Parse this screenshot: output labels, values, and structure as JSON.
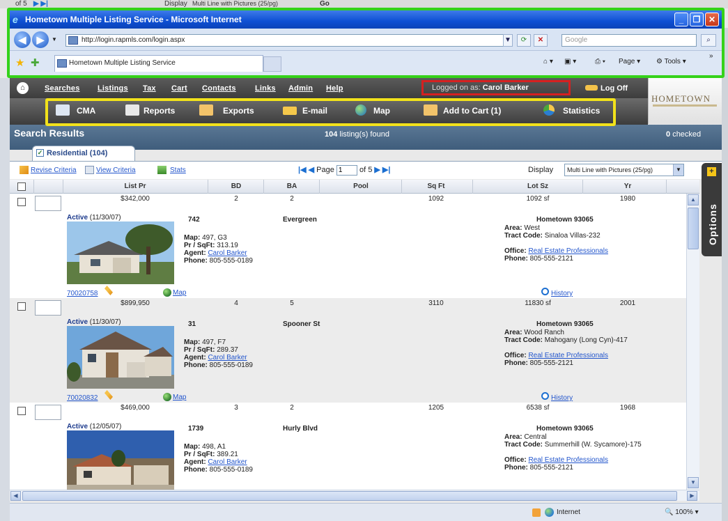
{
  "top_strip": {
    "pager_text": "of 5",
    "display_label": "Display",
    "display_value": "Multi Line with Pictures (25/pg)",
    "go": "Go"
  },
  "window": {
    "title": "Hometown Multiple Listing Service - Microsoft Internet"
  },
  "browser": {
    "url": "http://login.rapmls.com/login.aspx",
    "search_placeholder": "Google",
    "tab_title": "Hometown Multiple Listing Service",
    "page_menu": "Page",
    "tools_menu": "Tools"
  },
  "menu": {
    "items": [
      "Searches",
      "Listings",
      "Tax",
      "Cart",
      "Contacts",
      "Links",
      "Admin",
      "Help"
    ],
    "logged_on_prefix": "Logged on as:",
    "logged_on_user": "Carol Barker",
    "log_off": "Log Off"
  },
  "brand": {
    "name": "HOMETOWN"
  },
  "toolbar": {
    "cma": "CMA",
    "reports": "Reports",
    "exports": "Exports",
    "email": "E-mail",
    "map": "Map",
    "add_to_cart": "Add to Cart (1)",
    "statistics": "Statistics"
  },
  "results": {
    "title": "Search Results",
    "found_count": "104",
    "found_suffix": "listing(s) found",
    "checked_count": "0",
    "checked_suffix": "checked",
    "tab_label": "Residential (104)"
  },
  "criteria": {
    "revise": "Revise Criteria",
    "view": "View Criteria",
    "stats": "Stats",
    "page_label": "Page",
    "page_value": "1",
    "of_pages": "of 5",
    "display_label": "Display",
    "display_value": "Multi Line with Pictures (25/pg)"
  },
  "options_label": "Options",
  "table": {
    "headers": [
      "List Pr",
      "BD",
      "BA",
      "Pool",
      "Sq Ft",
      "Lot Sz",
      "Yr"
    ],
    "rows": [
      {
        "price": "$342,000",
        "bd": "2",
        "ba": "2",
        "pool": "",
        "sqft": "1092",
        "lot": "1092 sf",
        "yr": "1980",
        "status": "Active",
        "date": "(11/30/07)",
        "num": "742",
        "street": "Evergreen",
        "map": "497, G3",
        "pr_sqft": "313.19",
        "agent": "Carol Barker",
        "phone": "805-555-0189",
        "city": "Hometown 93065",
        "area": "West",
        "tract": "Sinaloa Villas-232",
        "office": "Real Estate Professionals",
        "office_phone": "805-555-2121",
        "mls": "70020758"
      },
      {
        "price": "$899,950",
        "bd": "4",
        "ba": "5",
        "pool": "",
        "sqft": "3110",
        "lot": "11830 sf",
        "yr": "2001",
        "status": "Active",
        "date": "(11/30/07)",
        "num": "31",
        "street": "Spooner St",
        "map": "497, F7",
        "pr_sqft": "289.37",
        "agent": "Carol Barker",
        "phone": "805-555-0189",
        "city": "Hometown 93065",
        "area": "Wood Ranch",
        "tract": "Mahogany (Long Cyn)-417",
        "office": "Real Estate Professionals",
        "office_phone": "805-555-2121",
        "mls": "70020832"
      },
      {
        "price": "$469,000",
        "bd": "3",
        "ba": "2",
        "pool": "",
        "sqft": "1205",
        "lot": "6538 sf",
        "yr": "1968",
        "status": "Active",
        "date": "(12/05/07)",
        "num": "1739",
        "street": "Hurly Blvd",
        "map": "498, A1",
        "pr_sqft": "389.21",
        "agent": "Carol Barker",
        "phone": "805-555-0189",
        "city": "Hometown 93065",
        "area": "Central",
        "tract": "Summerhill (W. Sycamore)-175",
        "office": "Real Estate Professionals",
        "office_phone": "805-555-2121",
        "mls": ""
      }
    ],
    "labels": {
      "map": "Map:",
      "pr_sqft": "Pr / SqFt:",
      "agent": "Agent:",
      "phone": "Phone:",
      "area": "Area:",
      "tract": "Tract Code:",
      "office": "Office:",
      "map_link": "Map",
      "history_link": "History"
    }
  },
  "statusbar": {
    "zone": "Internet",
    "zoom": "100%"
  }
}
